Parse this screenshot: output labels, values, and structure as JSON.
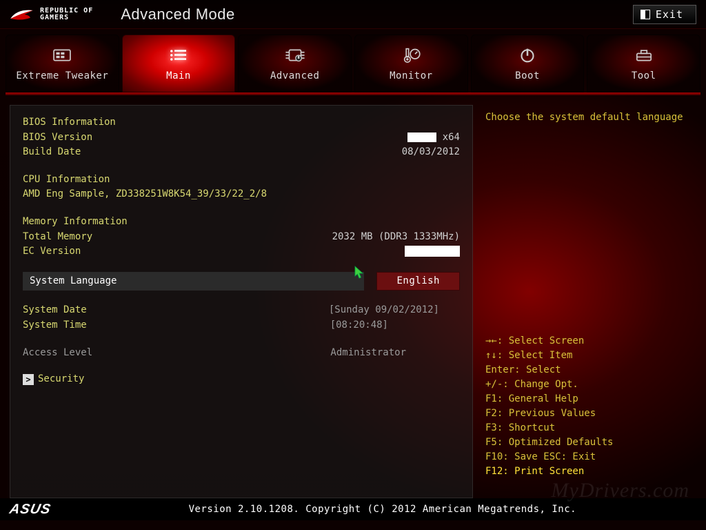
{
  "header": {
    "brand_line1": "REPUBLIC OF",
    "brand_line2": "GAMERS",
    "mode_title": "Advanced Mode",
    "exit_label": "Exit"
  },
  "tabs": [
    {
      "label": "Extreme Tweaker"
    },
    {
      "label": "Main"
    },
    {
      "label": "Advanced"
    },
    {
      "label": "Monitor"
    },
    {
      "label": "Boot"
    },
    {
      "label": "Tool"
    }
  ],
  "main": {
    "bios_info_title": "BIOS Information",
    "bios_version_label": "BIOS Version",
    "bios_version_value_suffix": "x64",
    "build_date_label": "Build Date",
    "build_date_value": "08/03/2012",
    "cpu_info_title": "CPU Information",
    "cpu_info_value": "AMD Eng Sample, ZD338251W8K54_39/33/22_2/8",
    "mem_info_title": "Memory Information",
    "total_memory_label": "Total Memory",
    "total_memory_value": "2032 MB (DDR3 1333MHz)",
    "ec_version_label": "EC Version",
    "system_language_label": "System Language",
    "system_language_value": "English",
    "system_date_label": "System Date",
    "system_date_value": "[Sunday 09/02/2012]",
    "system_time_label": "System Time",
    "system_time_value": "[08:20:48]",
    "access_level_label": "Access Level",
    "access_level_value": "Administrator",
    "security_label": "Security"
  },
  "help": {
    "top_text": "Choose the system default language",
    "lines": [
      "→←: Select Screen",
      "↑↓: Select Item",
      "Enter: Select",
      "+/-: Change Opt.",
      "F1: General Help",
      "F2: Previous Values",
      "F3: Shortcut",
      "F5: Optimized Defaults",
      "F10: Save  ESC: Exit"
    ],
    "highlight": "F12: Print Screen"
  },
  "footer": {
    "asus": "ASUS",
    "text": "Version 2.10.1208. Copyright (C) 2012 American Megatrends, Inc."
  },
  "watermark": "MyDrivers.com"
}
